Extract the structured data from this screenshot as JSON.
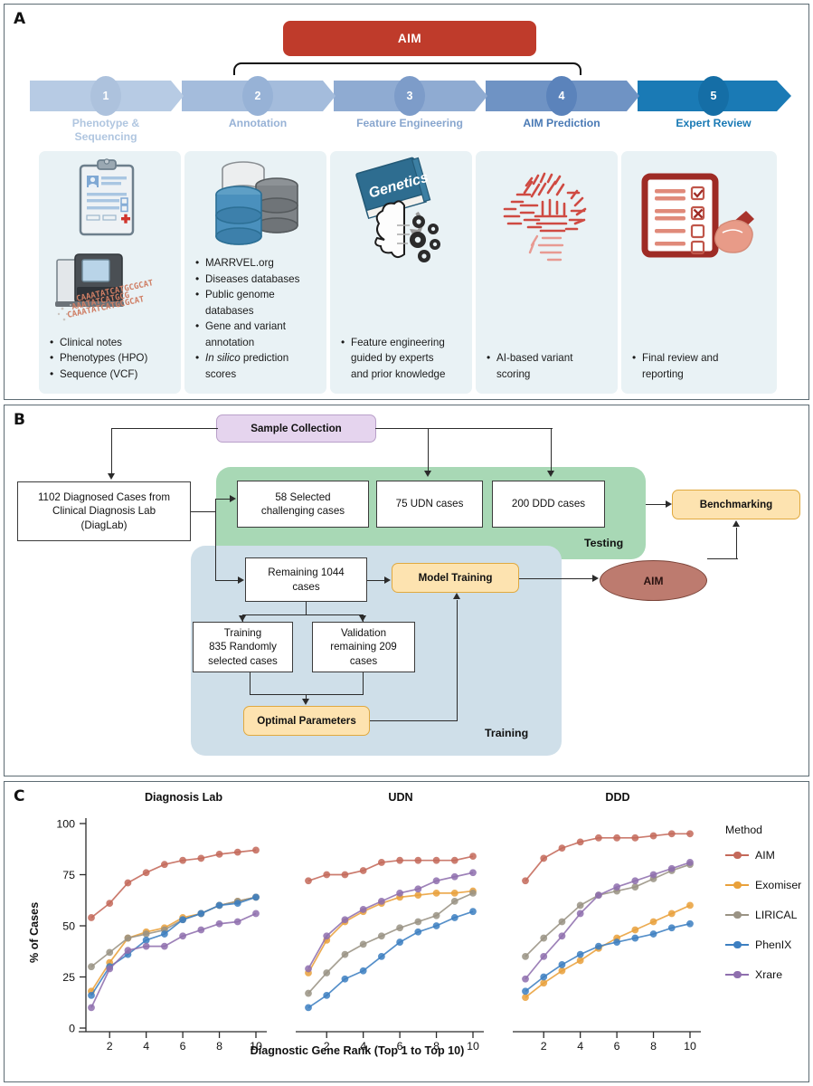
{
  "figure": {
    "panels": {
      "a": "A",
      "b": "B",
      "c": "C"
    }
  },
  "panelA": {
    "aim_banner": "AIM",
    "stages": [
      {
        "num": "1",
        "label_line1": "Phenotype &",
        "label_line2": "Sequencing",
        "chev_color": "#b7cbe4",
        "circle_color": "#adc2dd",
        "text_color": "#b0c6e0"
      },
      {
        "num": "2",
        "label_line1": "Annotation",
        "label_line2": "",
        "chev_color": "#a4bcdc",
        "circle_color": "#97b2d6",
        "text_color": "#97b2d6"
      },
      {
        "num": "3",
        "label_line1": "Feature Engineering",
        "label_line2": "",
        "chev_color": "#8fabd2",
        "circle_color": "#7d9cc9",
        "text_color": "#88a6ce"
      },
      {
        "num": "4",
        "label_line1": "AIM Prediction",
        "label_line2": "",
        "chev_color": "#6f93c4",
        "circle_color": "#5b83bb",
        "text_color": "#4a7ab5"
      },
      {
        "num": "5",
        "label_line1": "Expert Review",
        "label_line2": "",
        "chev_color": "#1a7ab5",
        "circle_color": "#156ea6",
        "text_color": "#1a7ab5"
      }
    ],
    "boxes": [
      {
        "icon": "clipboard-and-sequencer-icon",
        "bullets": [
          "Clinical notes",
          "Phenotypes (HPO)",
          "Sequence (VCF)"
        ]
      },
      {
        "icon": "database-stack-icon",
        "bullets": [
          "MARRVEL.org",
          "Diseases databases",
          "Public genome",
          "databases",
          "Gene and variant",
          "annotation",
          "In silico prediction",
          "scores"
        ],
        "continuation_indices": [
          3,
          5,
          7
        ],
        "italic_prefix_index": 6,
        "italic_prefix": "In silico"
      },
      {
        "icon": "genetics-book-and-brain-gears-icon",
        "bullets": [
          "Feature engineering",
          "guided by experts",
          "and prior knowledge"
        ],
        "continuation_indices": [
          1,
          2
        ]
      },
      {
        "icon": "circuit-brain-icon",
        "bullets": [
          "AI-based variant",
          "scoring"
        ],
        "continuation_indices": [
          1
        ]
      },
      {
        "icon": "checklist-with-hand-icon",
        "bullets": [
          "Final review and",
          "reporting"
        ],
        "continuation_indices": [
          1
        ]
      }
    ],
    "book_label": "Genetics"
  },
  "panelB": {
    "sample_collection": "Sample Collection",
    "diaglab": "1102 Diagnosed Cases from\nClinical Diagnosis Lab\n(DiagLab)",
    "diaglab_lines": [
      "1102 Diagnosed Cases from",
      "Clinical Diagnosis Lab",
      "(DiagLab)"
    ],
    "testing_group_label": "Testing",
    "training_group_label": "Training",
    "testing_nodes": [
      {
        "lines": [
          "58 Selected",
          "challenging cases"
        ]
      },
      {
        "lines": [
          "75 UDN cases"
        ]
      },
      {
        "lines": [
          "200 DDD cases"
        ]
      }
    ],
    "benchmarking": "Benchmarking",
    "remaining_cases": [
      "Remaining 1044",
      "cases"
    ],
    "model_training": "Model Training",
    "aim_node": "AIM",
    "training_split": [
      {
        "lines": [
          "Training",
          "835 Randomly",
          "selected cases"
        ]
      },
      {
        "lines": [
          "Validation",
          "remaining 209",
          "cases"
        ]
      }
    ],
    "optimal_parameters": "Optimal Parameters"
  },
  "panelC": {
    "legend_title": "Method",
    "chart_data": {
      "type": "line",
      "title": "",
      "xlabel": "Diagnostic Gene Rank (Top 1 to Top 10)",
      "ylabel": "% of Cases",
      "ylim": [
        0,
        100
      ],
      "yticks": [
        0,
        25,
        50,
        75,
        100
      ],
      "xticks": [
        2,
        4,
        6,
        8,
        10
      ],
      "x": [
        1,
        2,
        3,
        4,
        5,
        6,
        7,
        8,
        9,
        10
      ],
      "grid": false,
      "legend_position": "right",
      "legend": [
        "AIM",
        "Exomiser",
        "LIRICAL",
        "PhenIX",
        "Xrare"
      ],
      "colors": {
        "AIM": "#c4695a",
        "Exomiser": "#e9a13b",
        "LIRICAL": "#9a9384",
        "PhenIX": "#3d7fc1",
        "Xrare": "#8f6fae"
      },
      "panels": [
        {
          "title": "Diagnosis Lab",
          "series": [
            {
              "name": "AIM",
              "values": [
                54,
                61,
                71,
                76,
                80,
                82,
                83,
                85,
                86,
                87
              ]
            },
            {
              "name": "Exomiser",
              "values": [
                18,
                32,
                44,
                47,
                49,
                54,
                56,
                60,
                62,
                64
              ]
            },
            {
              "name": "LIRICAL",
              "values": [
                30,
                37,
                44,
                46,
                48,
                53,
                56,
                60,
                62,
                64
              ]
            },
            {
              "name": "PhenIX",
              "values": [
                16,
                30,
                36,
                43,
                46,
                53,
                56,
                60,
                61,
                64
              ]
            },
            {
              "name": "Xrare",
              "values": [
                10,
                29,
                38,
                40,
                40,
                45,
                48,
                51,
                52,
                56
              ]
            }
          ]
        },
        {
          "title": "UDN",
          "series": [
            {
              "name": "AIM",
              "values": [
                72,
                75,
                75,
                77,
                81,
                82,
                82,
                82,
                82,
                84
              ]
            },
            {
              "name": "Exomiser",
              "values": [
                27,
                43,
                52,
                57,
                61,
                64,
                65,
                66,
                66,
                67
              ]
            },
            {
              "name": "LIRICAL",
              "values": [
                17,
                27,
                36,
                41,
                45,
                49,
                52,
                55,
                62,
                66
              ]
            },
            {
              "name": "PhenIX",
              "values": [
                10,
                16,
                24,
                28,
                35,
                42,
                47,
                50,
                54,
                57
              ]
            },
            {
              "name": "Xrare",
              "values": [
                29,
                45,
                53,
                58,
                62,
                66,
                68,
                72,
                74,
                76
              ]
            }
          ]
        },
        {
          "title": "DDD",
          "series": [
            {
              "name": "AIM",
              "values": [
                72,
                83,
                88,
                91,
                93,
                93,
                93,
                94,
                95,
                95
              ]
            },
            {
              "name": "Exomiser",
              "values": [
                15,
                22,
                28,
                33,
                39,
                44,
                48,
                52,
                56,
                60
              ]
            },
            {
              "name": "LIRICAL",
              "values": [
                35,
                44,
                52,
                60,
                65,
                67,
                69,
                73,
                77,
                80
              ]
            },
            {
              "name": "PhenIX",
              "values": [
                18,
                25,
                31,
                36,
                40,
                42,
                44,
                46,
                49,
                51
              ]
            },
            {
              "name": "Xrare",
              "values": [
                24,
                35,
                45,
                56,
                65,
                69,
                72,
                75,
                78,
                81
              ]
            }
          ]
        }
      ]
    }
  }
}
